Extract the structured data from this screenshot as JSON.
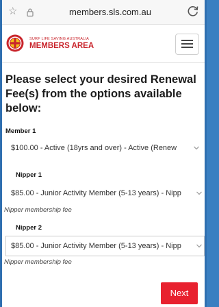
{
  "browser": {
    "url": "members.sls.com.au",
    "star_icon": "star-icon",
    "lock_icon": "lock-icon",
    "reload_icon": "reload-icon"
  },
  "header": {
    "brand_small": "SURF LIFE SAVING AUSTRALIA",
    "brand_big": "MEMBERS AREA",
    "logo_icon": "sls-logo-icon",
    "menu_icon": "hamburger-menu-icon"
  },
  "main": {
    "heading": "Please select your desired Renewal Fee(s) from the options available below:",
    "fields": [
      {
        "label": "Member 1",
        "selected": "$100.00 - Active (18yrs and over) - Active (Renew"
      },
      {
        "label": "Nipper 1",
        "selected": "$85.00 - Junior Activity Member (5-13 years) - Nipp",
        "helper": "Nipper membership fee"
      },
      {
        "label": "Nipper 2",
        "selected": "$85.00 - Junior Activity Member (5-13 years) - Nipp",
        "helper": "Nipper membership fee"
      }
    ],
    "next_label": "Next"
  },
  "colors": {
    "accent": "#e8212f",
    "brand": "#c9252c",
    "frame": "#3a7fc1"
  }
}
